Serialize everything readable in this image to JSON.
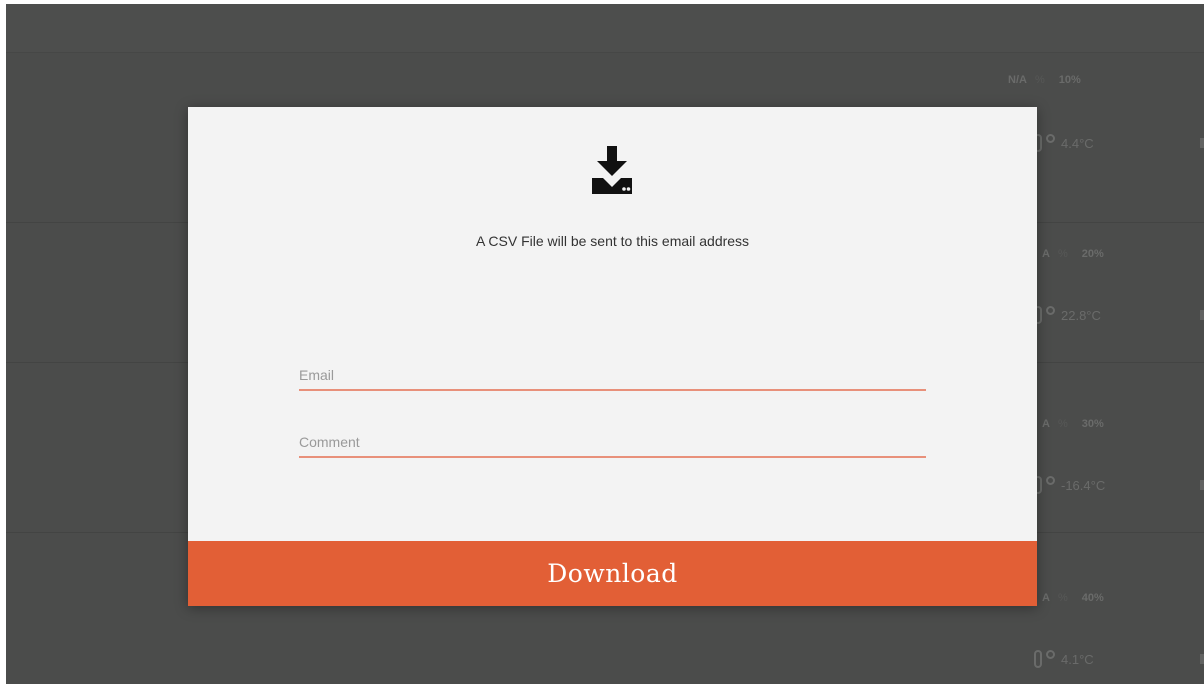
{
  "modal": {
    "icon": "download-to-drive-icon",
    "message": "A CSV File will be sent to this email address",
    "email": {
      "placeholder": "Email",
      "value": ""
    },
    "comment": {
      "placeholder": "Comment",
      "value": ""
    },
    "download_label": "Download"
  },
  "background_list": {
    "rows": [
      {
        "status": "N/A",
        "unit": "%",
        "percent": "10%",
        "temperature": "4.4°C"
      },
      {
        "status": "A",
        "unit": "%",
        "percent": "20%",
        "temperature": "22.8°C"
      },
      {
        "status": "A",
        "unit": "%",
        "percent": "30%",
        "temperature": "-16.4°C"
      },
      {
        "status": "A",
        "unit": "%",
        "percent": "40%",
        "temperature": "4.1°C"
      }
    ]
  },
  "colors": {
    "accent": "#e25f36",
    "field_underline": "#e8907a",
    "overlay": "#4b4c4b",
    "modal_bg": "#f3f3f3"
  }
}
